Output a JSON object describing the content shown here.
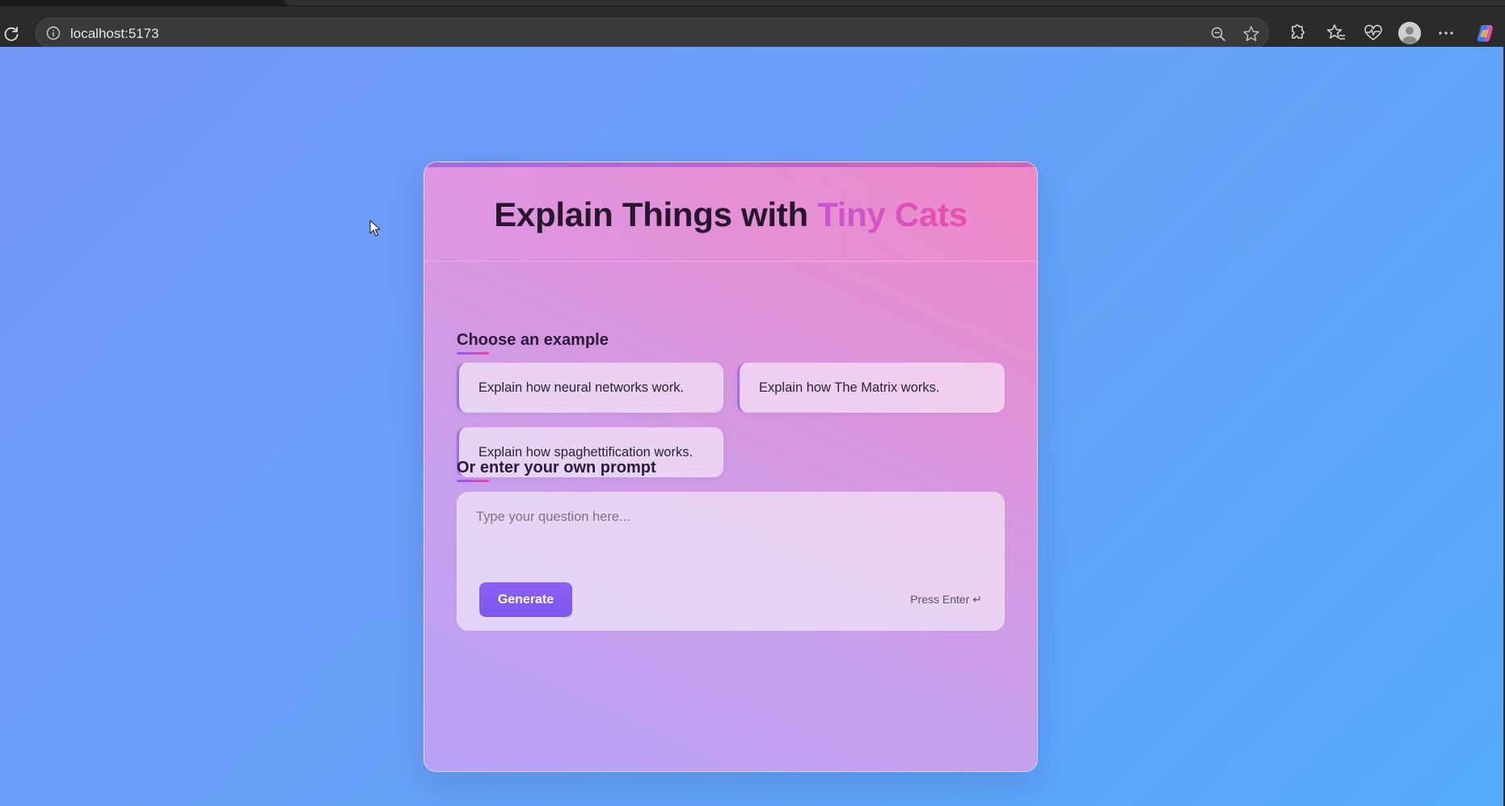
{
  "browser": {
    "url": "localhost:5173"
  },
  "page": {
    "title_main": "Explain Things with ",
    "title_accent": "Tiny Cats",
    "examples_label": "Choose an example",
    "examples": [
      "Explain how neural networks work.",
      "Explain how The Matrix works.",
      "Explain how spaghettification works."
    ],
    "prompt_label": "Or enter your own prompt",
    "prompt_placeholder": "Type your question here...",
    "generate_label": "Generate",
    "hint": "Press Enter ↵"
  },
  "colors": {
    "accent_purple": "#8c60f2",
    "accent_pink": "#ea4fa8"
  }
}
